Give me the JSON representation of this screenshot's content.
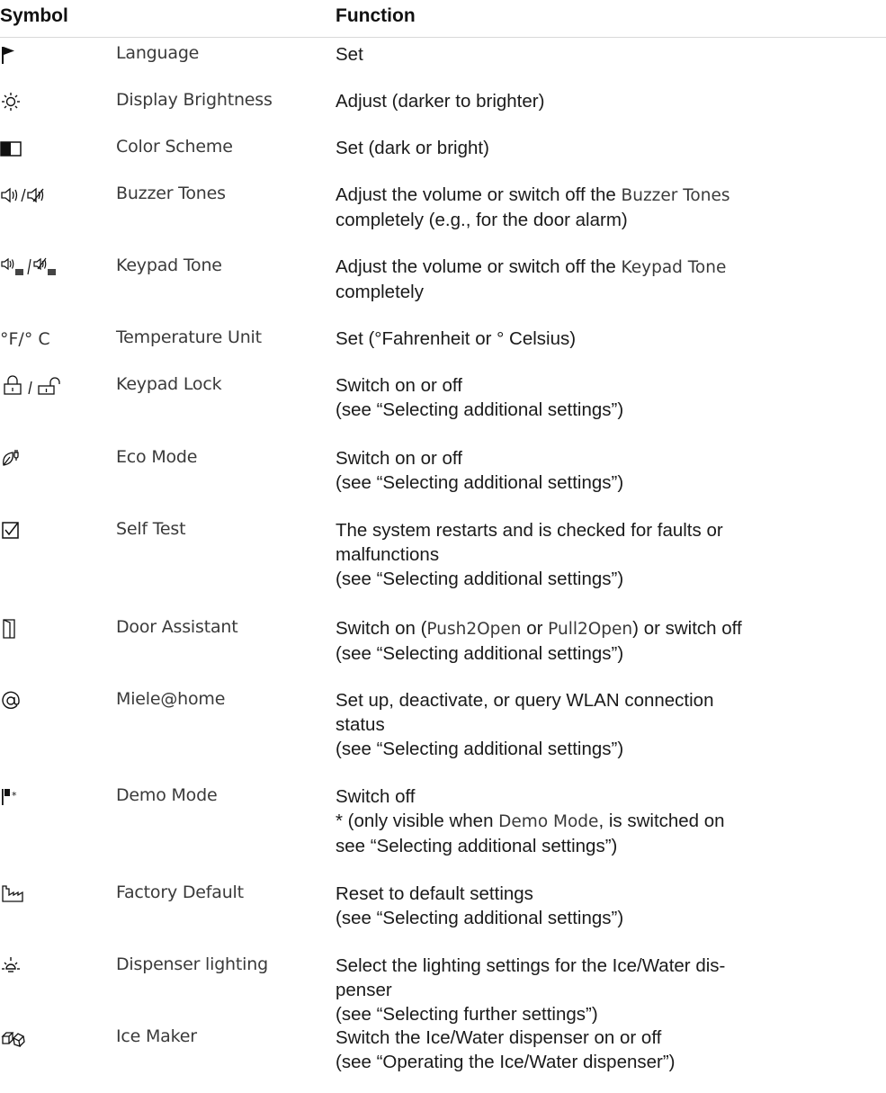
{
  "header": {
    "symbol": "Symbol",
    "function": "Function"
  },
  "rows": [
    {
      "icon": "flag-icon",
      "name": "Language",
      "lines": [
        "Set"
      ]
    },
    {
      "icon": "sun-icon",
      "name": "Display Brightness",
      "lines": [
        "Adjust (darker to brighter)"
      ]
    },
    {
      "icon": "color-scheme-icon",
      "name": "Color Scheme",
      "lines": [
        "Set (dark or bright)"
      ]
    },
    {
      "icon": "speaker-icon",
      "name": "Buzzer Tones",
      "lines": [
        "Adjust the volume or switch off the ",
        "completely (e.g., for the door alarm)"
      ],
      "inline": "Buzzer Tones"
    },
    {
      "icon": "keypad-speaker-icon",
      "name": "Keypad Tone",
      "lines": [
        "Adjust the volume or switch off the ",
        "completely"
      ],
      "inline": "Keypad Tone"
    },
    {
      "icon": "temperature-unit-text",
      "symbol_text": "°F/° C",
      "name": "Temperature Unit",
      "lines": [
        "Set (°Fahrenheit or ° Celsius)"
      ]
    },
    {
      "icon": "lock-icon",
      "name": "Keypad Lock",
      "lines": [
        "Switch on or off",
        "(see “Selecting additional settings”)"
      ]
    },
    {
      "icon": "eco-plug-icon",
      "name": "Eco Mode",
      "lines": [
        "Switch on or off",
        "(see “Selecting additional settings”)"
      ]
    },
    {
      "icon": "checkbox-icon",
      "name": "Self Test",
      "lines": [
        "The system restarts and is checked for faults or",
        "malfunctions",
        "(see “Selecting additional settings”)"
      ]
    },
    {
      "icon": "door-icon",
      "name": "Door Assistant",
      "line1_parts": [
        "Switch on (",
        "Push2Open",
        " or ",
        "Pull2Open",
        ") or switch off"
      ],
      "lines": [
        "",
        "(see “Selecting additional settings”)"
      ]
    },
    {
      "icon": "at-icon",
      "name": "Miele@home",
      "lines": [
        "Set up, deactivate, or query WLAN connection",
        "status",
        "(see “Selecting additional settings”)"
      ]
    },
    {
      "icon": "demo-flag-icon",
      "name": "Demo Mode",
      "lines": [
        "Switch off",
        "",
        "see “Selecting additional settings”)"
      ],
      "line2_parts": [
        "* (only visible when ",
        "Demo Mode",
        ", is switched on"
      ]
    },
    {
      "icon": "factory-icon",
      "name": "Factory Default",
      "lines": [
        "Reset to default settings",
        "(see “Selecting additional settings”)"
      ]
    },
    {
      "icon": "dispenser-light-icon",
      "name": "Dispenser lighting",
      "lines": [
        "Select the lighting settings for the Ice/Water dis-",
        "penser",
        "(see “Selecting further settings”)"
      ]
    },
    {
      "icon": "ice-cubes-icon",
      "name": "Ice Maker",
      "lines": [
        "Switch the Ice/Water dispenser on or off",
        "(see “Operating the Ice/Water dispenser”)"
      ]
    }
  ]
}
